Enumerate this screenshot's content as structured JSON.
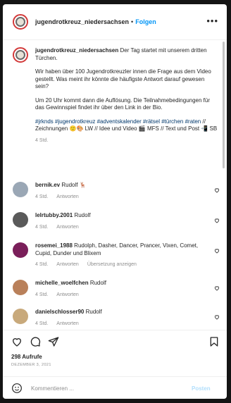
{
  "post": {
    "username": "jugendrotkreuz_niedersachsen",
    "separator": "•",
    "follow_label": "Folgen",
    "more_label": "•••"
  },
  "caption": {
    "username": "jugendrotkreuz_niedersachsen",
    "p1": "Der Tag startet mit unserem dritten Türchen.",
    "p2": "Wir haben über 100 Jugendrotkreuzler innen die Frage aus dem Video gestellt. Was meint ihr könnte die häufigste Antwort darauf gewesen sein?",
    "p3": "Um 20 Uhr kommt dann die Auflösung. Die Teilnahmebedingungen für das Gewinnspiel findet ihr über den Link in der Bio.",
    "hashtags": "#jrknds #jugendrotkreuz #adventskalender #rätsel #türchen #raten",
    "credits": "// Zeichnungen 🙂🎨 LW // Idee und Video 🎬 MFS // Text und Post 📲 SB",
    "time": "4 Std."
  },
  "comments": [
    {
      "username": "bernik.ev",
      "text": "Rudolf 🦌",
      "time": "4 Std.",
      "reply": "Antworten",
      "extra": "",
      "color": "#9aa7b5"
    },
    {
      "username": "lelrtubby.2001",
      "text": "Rudolf",
      "time": "4 Std.",
      "reply": "Antworten",
      "extra": "",
      "color": "#5a5a5a"
    },
    {
      "username": "rosemei_1988",
      "text": "Rudolph, Dasher, Dancer, Prancer, Vixen, Comet, Cupid, Dunder und Blixem",
      "time": "4 Std.",
      "reply": "Antworten",
      "extra": "Übersetzung anzeigen",
      "color": "#7a1f5a"
    },
    {
      "username": "michelle_woelfchen",
      "text": "Rudolf",
      "time": "4 Std.",
      "reply": "Antworten",
      "extra": "",
      "color": "#b9805a"
    },
    {
      "username": "danielschlosser90",
      "text": "Rudolf",
      "time": "4 Std.",
      "reply": "Antworten",
      "extra": "",
      "color": "#c8a97b"
    }
  ],
  "actions": {
    "likes": "298 Aufrufe",
    "date": "DEZEMBER 3, 2021"
  },
  "composer": {
    "placeholder": "Kommentieren ...",
    "post_label": "Posten"
  },
  "colors": {
    "follow": "#0095f6",
    "avatar_ring": "#d23a3a"
  }
}
